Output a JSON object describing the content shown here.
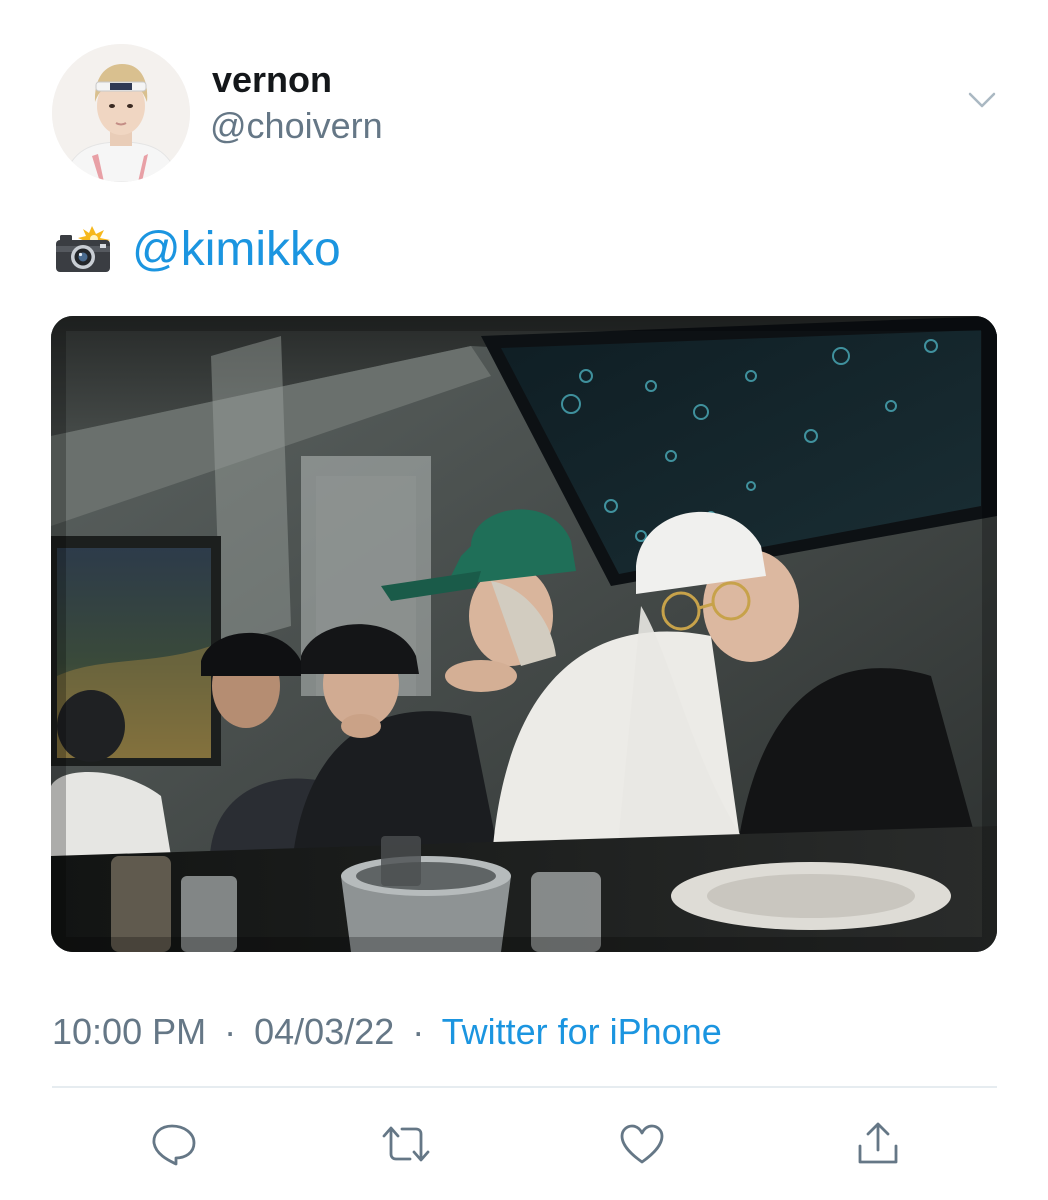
{
  "tweet": {
    "display_name": "vernon",
    "handle": "@choivern",
    "text_emoji_icon": "camera-with-flash-icon",
    "mention": "@kimikko",
    "time": "10:00 PM",
    "date": "04/03/22",
    "separator": "·",
    "source": "Twitter for iPhone"
  },
  "icons": {
    "more": "chevron-down-icon",
    "reply": "reply-bubble-icon",
    "retweet": "retweet-icon",
    "like": "heart-icon",
    "share": "share-icon"
  },
  "colors": {
    "text_primary": "#14171a",
    "text_secondary": "#657786",
    "link": "#1b95e0",
    "divider": "#e6ecf0"
  }
}
